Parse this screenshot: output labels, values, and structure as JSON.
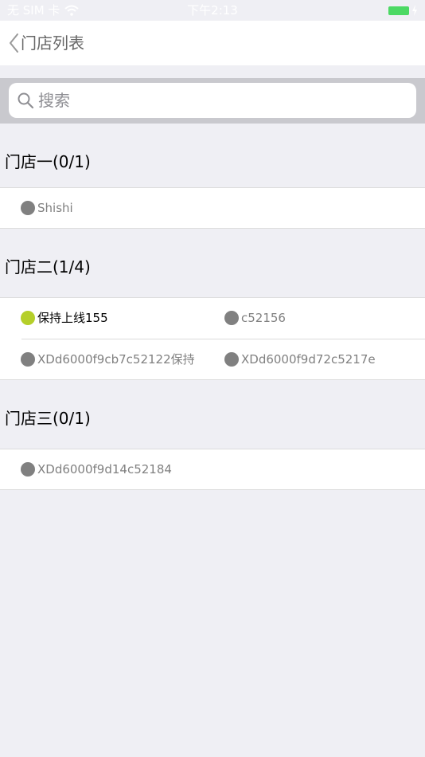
{
  "status_bar": {
    "carrier": "无 SIM 卡",
    "time": "下午2:13"
  },
  "nav": {
    "title": "门店列表"
  },
  "search": {
    "placeholder": "搜索",
    "value": ""
  },
  "colors": {
    "online": "#b5cf2a",
    "offline": "#808080",
    "battery": "#4cd964"
  },
  "sections": [
    {
      "title": "门店一(0/1)",
      "devices": [
        {
          "name": "Shishi",
          "online": false
        }
      ]
    },
    {
      "title": "门店二(1/4)",
      "devices": [
        {
          "name": "保持上线155",
          "online": true
        },
        {
          "name": "c52156",
          "online": false
        },
        {
          "name": "XDd6000f9cb7c52122保持",
          "online": false
        },
        {
          "name": "XDd6000f9d72c5217e",
          "online": false
        }
      ]
    },
    {
      "title": "门店三(0/1)",
      "devices": [
        {
          "name": "XDd6000f9d14c52184",
          "online": false
        }
      ]
    }
  ]
}
